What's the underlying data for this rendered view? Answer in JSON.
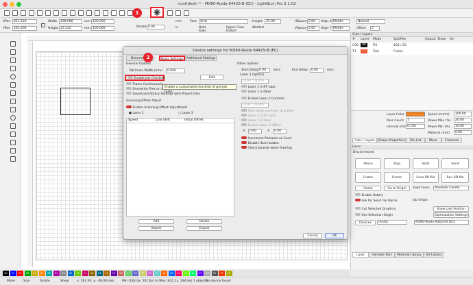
{
  "window": {
    "title": "<untitled> * - MX80-Ruida 6442S-B (EC) - LightBurn Pro 2.1.02"
  },
  "toolbar": {
    "xpos_label": "XPos",
    "xpos_value": "621.126",
    "ypos_label": "YPos",
    "ypos_value": "261.605",
    "width_label": "Width",
    "width_value": "438.086",
    "height_label": "Height",
    "height_value": "23.222",
    "w_pct": "100.000",
    "h_pct": "100.000",
    "unit": "mm",
    "rotate_label": "Rotate",
    "rotate_value": "0.00",
    "font_label": "Font",
    "font_value": "Arial",
    "height2_label": "Height",
    "height2_value": "25.00",
    "hspace_label": "HSpace",
    "hspace_value": "0.00",
    "vspace_label": "VSpace",
    "vspace_value": "0.00",
    "alignx_label": "Align X",
    "alignx_value": "Middle",
    "aligny_label": "Align Y",
    "aligny_value": "Middle",
    "normal_label": "Normal",
    "offset_label": "Offset",
    "offset_value": "0",
    "bold": "Bold",
    "italic": "Italic",
    "upper_case": "Upper Case",
    "welded": "Welded",
    "distort": "Distort",
    "mm": "mm",
    "in": "in"
  },
  "annotations": {
    "one": "1",
    "two": "2"
  },
  "dialog": {
    "title": "Device settings for MX80-Ruida 6442S-B (EC)",
    "tabs": [
      "Dimensions",
      "Basic Settings",
      "Additional Settings"
    ],
    "general_options": "General Options",
    "tab_pulse_label": "Tab Pulse Width (mm)",
    "tab_pulse_value": "0.050",
    "enable_job_checklist": "Enable Job Checklist",
    "edit": "Edit",
    "tooltip": "Enable a customized checklist of pre-job tasks",
    "frame_continuously": "Frame Continuously",
    "overwrite_files": "Overwrite Files on Device",
    "save_load_rotary": "Save/Load Rotary Settings with Project Files",
    "scan_offset_adjust": "Scanning Offset Adjust",
    "enable_scan_offset": "Enable Scanning Offset Adjustment",
    "laser1": "Laser 1",
    "laser2": "Laser 2",
    "cols": [
      "Speed",
      "Line Shift",
      "Initial Offset"
    ],
    "add": "Add",
    "delete": "Delete",
    "import": "Import",
    "export": "Export",
    "other_options": "Other options",
    "start_delay_label": "Start Delay:",
    "start_delay_value": "0.00",
    "end_delay_label": "End Delay:",
    "end_delay_value": "0.00",
    "secs": "secs",
    "laser1_options": "Laser 1 Options",
    "laser1_name": "Laser 1 Name",
    "laser1_rf": "Laser 1 is RF tube",
    "laser1_fiber": "Laser 1 is Fiber",
    "enable_laser2": "Enable Laser 2 Controls",
    "laser2_name": "Laser 2 Name",
    "only_one_laser": "Only allow one laser at a time",
    "laser2_rf": "Laser 2 is RF tube",
    "laser2_fiber": "Laser 2 is Fiber",
    "laser2_offset": "Enable Laser 2 Offset",
    "x_label": "X:",
    "y_label": "Y:",
    "x_value": "0.00",
    "y_value": "0.00",
    "increment_filename": "Increment filename on Send",
    "disable_start": "Disable Start button",
    "check_bounds": "Check bounds when framing",
    "cancel": "Cancel",
    "ok": "OK"
  },
  "cuts": {
    "title": "Cuts / Layers",
    "cols": [
      "#",
      "Layer",
      "Mode",
      "Spd/Pwr",
      "Output",
      "Show",
      "Air"
    ],
    "rows": [
      {
        "num": "C00",
        "layer": "00",
        "mode": "Fill",
        "spd": "100 / 20"
      },
      {
        "num": "T1",
        "layer": "T1",
        "mode": "Tool",
        "spd": "Frame"
      }
    ],
    "layer_color": "Layer Color",
    "speed_label": "Speed (mm/s)",
    "speed_value": "100.00",
    "pass_count": "Pass Count",
    "pass_value": "1",
    "power_max_label": "Power Max (%)",
    "power_max_value": "20.00",
    "interval_label": "Interval (mm)",
    "interval_value": "0.100",
    "power_min_label": "Power Min (%)",
    "power_min_value": "10.00",
    "material_label": "Material (mm)",
    "material_value": "0.00"
  },
  "rtabs": [
    "Cuts / Layers",
    "Shape Properties",
    "File List",
    "Move",
    "Cameras"
  ],
  "laser": {
    "title": "Laser",
    "status": "Disconnected",
    "pause": "Pause",
    "stop": "Stop",
    "start": "Start",
    "send": "Send",
    "frame1": "Frame",
    "frame2": "Frame",
    "save_rd": "Save RD file",
    "run_rd": "Run RD file",
    "home": "Home",
    "go_to_origin": "Go to Origin",
    "start_from_label": "Start From:",
    "start_from_value": "Absolute Coords",
    "enable_rotary": "Enable Rotary",
    "ask_send": "Ask for Send File Name",
    "job_origin": "Job Origin",
    "cut_selected": "Cut Selected Graphics",
    "show_last_position": "Show Last Position",
    "use_selection_origin": "Use Selection Origin",
    "opt_settings": "Optimization Settings",
    "devices_label": "Devices",
    "devices_value": "(Auto)",
    "device_select": "MX80-Ruida 6442S-B (EC)"
  },
  "btabs": [
    "Laser",
    "Variable Text",
    "Material Library",
    "Art Library"
  ],
  "palette": [
    "00",
    "01",
    "02",
    "03",
    "04",
    "05",
    "06",
    "07",
    "08",
    "09",
    "10",
    "11",
    "12",
    "13",
    "14",
    "15",
    "16",
    "17",
    "18",
    "19",
    "20",
    "21",
    "22",
    "23",
    "24",
    "25",
    "26",
    "27",
    "28",
    "29",
    "T1",
    "T2"
  ],
  "palette_colors": [
    "#000000",
    "#0000ff",
    "#ff0000",
    "#00aa00",
    "#ccaa00",
    "#ff8800",
    "#00aaaa",
    "#aa00aa",
    "#888888",
    "#0066cc",
    "#66cc00",
    "#cc0066",
    "#886600",
    "#006688",
    "#aa6600",
    "#6600aa",
    "#cc6666",
    "#66cc66",
    "#6666cc",
    "#cccc66",
    "#cc66cc",
    "#66cccc",
    "#ff6600",
    "#0066ff",
    "#ff0066",
    "#66ff00",
    "#00ff66",
    "#6600ff",
    "#aaaaaa",
    "#555555",
    "#ee3300",
    "#aaaa00"
  ],
  "status": {
    "move": "Move",
    "size": "Size",
    "rotate": "Rotate",
    "shear": "Shear",
    "coords": "x: 561.00, y: -39.00 mm",
    "minmax": "Min (183.0x, 261.6y) to Max (621.1x, 284.8y)  1 objects",
    "device": "No device found"
  }
}
